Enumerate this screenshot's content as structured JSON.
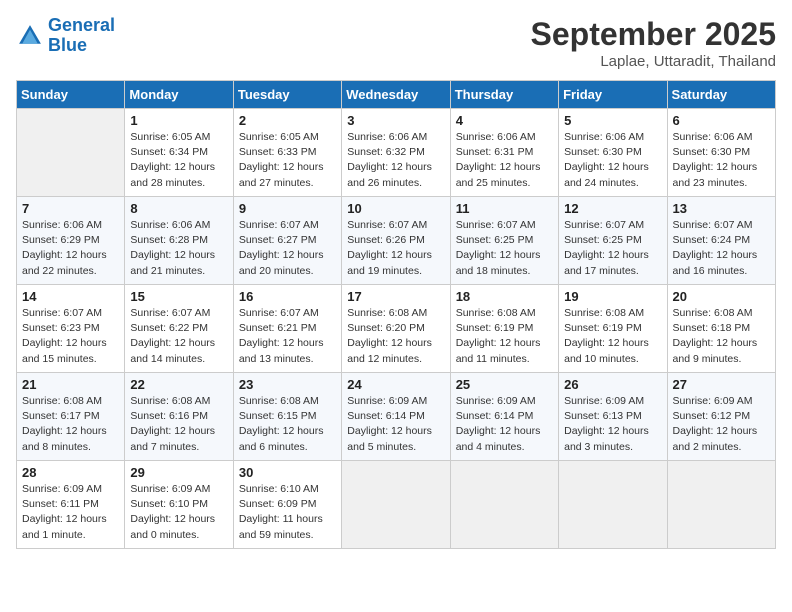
{
  "logo": {
    "line1": "General",
    "line2": "Blue"
  },
  "title": "September 2025",
  "location": "Laplae, Uttaradit, Thailand",
  "days_of_week": [
    "Sunday",
    "Monday",
    "Tuesday",
    "Wednesday",
    "Thursday",
    "Friday",
    "Saturday"
  ],
  "weeks": [
    [
      {
        "day": "",
        "empty": true
      },
      {
        "day": "1",
        "sunrise": "Sunrise: 6:05 AM",
        "sunset": "Sunset: 6:34 PM",
        "daylight": "Daylight: 12 hours and 28 minutes."
      },
      {
        "day": "2",
        "sunrise": "Sunrise: 6:05 AM",
        "sunset": "Sunset: 6:33 PM",
        "daylight": "Daylight: 12 hours and 27 minutes."
      },
      {
        "day": "3",
        "sunrise": "Sunrise: 6:06 AM",
        "sunset": "Sunset: 6:32 PM",
        "daylight": "Daylight: 12 hours and 26 minutes."
      },
      {
        "day": "4",
        "sunrise": "Sunrise: 6:06 AM",
        "sunset": "Sunset: 6:31 PM",
        "daylight": "Daylight: 12 hours and 25 minutes."
      },
      {
        "day": "5",
        "sunrise": "Sunrise: 6:06 AM",
        "sunset": "Sunset: 6:30 PM",
        "daylight": "Daylight: 12 hours and 24 minutes."
      },
      {
        "day": "6",
        "sunrise": "Sunrise: 6:06 AM",
        "sunset": "Sunset: 6:30 PM",
        "daylight": "Daylight: 12 hours and 23 minutes."
      }
    ],
    [
      {
        "day": "7",
        "sunrise": "Sunrise: 6:06 AM",
        "sunset": "Sunset: 6:29 PM",
        "daylight": "Daylight: 12 hours and 22 minutes."
      },
      {
        "day": "8",
        "sunrise": "Sunrise: 6:06 AM",
        "sunset": "Sunset: 6:28 PM",
        "daylight": "Daylight: 12 hours and 21 minutes."
      },
      {
        "day": "9",
        "sunrise": "Sunrise: 6:07 AM",
        "sunset": "Sunset: 6:27 PM",
        "daylight": "Daylight: 12 hours and 20 minutes."
      },
      {
        "day": "10",
        "sunrise": "Sunrise: 6:07 AM",
        "sunset": "Sunset: 6:26 PM",
        "daylight": "Daylight: 12 hours and 19 minutes."
      },
      {
        "day": "11",
        "sunrise": "Sunrise: 6:07 AM",
        "sunset": "Sunset: 6:25 PM",
        "daylight": "Daylight: 12 hours and 18 minutes."
      },
      {
        "day": "12",
        "sunrise": "Sunrise: 6:07 AM",
        "sunset": "Sunset: 6:25 PM",
        "daylight": "Daylight: 12 hours and 17 minutes."
      },
      {
        "day": "13",
        "sunrise": "Sunrise: 6:07 AM",
        "sunset": "Sunset: 6:24 PM",
        "daylight": "Daylight: 12 hours and 16 minutes."
      }
    ],
    [
      {
        "day": "14",
        "sunrise": "Sunrise: 6:07 AM",
        "sunset": "Sunset: 6:23 PM",
        "daylight": "Daylight: 12 hours and 15 minutes."
      },
      {
        "day": "15",
        "sunrise": "Sunrise: 6:07 AM",
        "sunset": "Sunset: 6:22 PM",
        "daylight": "Daylight: 12 hours and 14 minutes."
      },
      {
        "day": "16",
        "sunrise": "Sunrise: 6:07 AM",
        "sunset": "Sunset: 6:21 PM",
        "daylight": "Daylight: 12 hours and 13 minutes."
      },
      {
        "day": "17",
        "sunrise": "Sunrise: 6:08 AM",
        "sunset": "Sunset: 6:20 PM",
        "daylight": "Daylight: 12 hours and 12 minutes."
      },
      {
        "day": "18",
        "sunrise": "Sunrise: 6:08 AM",
        "sunset": "Sunset: 6:19 PM",
        "daylight": "Daylight: 12 hours and 11 minutes."
      },
      {
        "day": "19",
        "sunrise": "Sunrise: 6:08 AM",
        "sunset": "Sunset: 6:19 PM",
        "daylight": "Daylight: 12 hours and 10 minutes."
      },
      {
        "day": "20",
        "sunrise": "Sunrise: 6:08 AM",
        "sunset": "Sunset: 6:18 PM",
        "daylight": "Daylight: 12 hours and 9 minutes."
      }
    ],
    [
      {
        "day": "21",
        "sunrise": "Sunrise: 6:08 AM",
        "sunset": "Sunset: 6:17 PM",
        "daylight": "Daylight: 12 hours and 8 minutes."
      },
      {
        "day": "22",
        "sunrise": "Sunrise: 6:08 AM",
        "sunset": "Sunset: 6:16 PM",
        "daylight": "Daylight: 12 hours and 7 minutes."
      },
      {
        "day": "23",
        "sunrise": "Sunrise: 6:08 AM",
        "sunset": "Sunset: 6:15 PM",
        "daylight": "Daylight: 12 hours and 6 minutes."
      },
      {
        "day": "24",
        "sunrise": "Sunrise: 6:09 AM",
        "sunset": "Sunset: 6:14 PM",
        "daylight": "Daylight: 12 hours and 5 minutes."
      },
      {
        "day": "25",
        "sunrise": "Sunrise: 6:09 AM",
        "sunset": "Sunset: 6:14 PM",
        "daylight": "Daylight: 12 hours and 4 minutes."
      },
      {
        "day": "26",
        "sunrise": "Sunrise: 6:09 AM",
        "sunset": "Sunset: 6:13 PM",
        "daylight": "Daylight: 12 hours and 3 minutes."
      },
      {
        "day": "27",
        "sunrise": "Sunrise: 6:09 AM",
        "sunset": "Sunset: 6:12 PM",
        "daylight": "Daylight: 12 hours and 2 minutes."
      }
    ],
    [
      {
        "day": "28",
        "sunrise": "Sunrise: 6:09 AM",
        "sunset": "Sunset: 6:11 PM",
        "daylight": "Daylight: 12 hours and 1 minute."
      },
      {
        "day": "29",
        "sunrise": "Sunrise: 6:09 AM",
        "sunset": "Sunset: 6:10 PM",
        "daylight": "Daylight: 12 hours and 0 minutes."
      },
      {
        "day": "30",
        "sunrise": "Sunrise: 6:10 AM",
        "sunset": "Sunset: 6:09 PM",
        "daylight": "Daylight: 11 hours and 59 minutes."
      },
      {
        "day": "",
        "empty": true
      },
      {
        "day": "",
        "empty": true
      },
      {
        "day": "",
        "empty": true
      },
      {
        "day": "",
        "empty": true
      }
    ]
  ]
}
